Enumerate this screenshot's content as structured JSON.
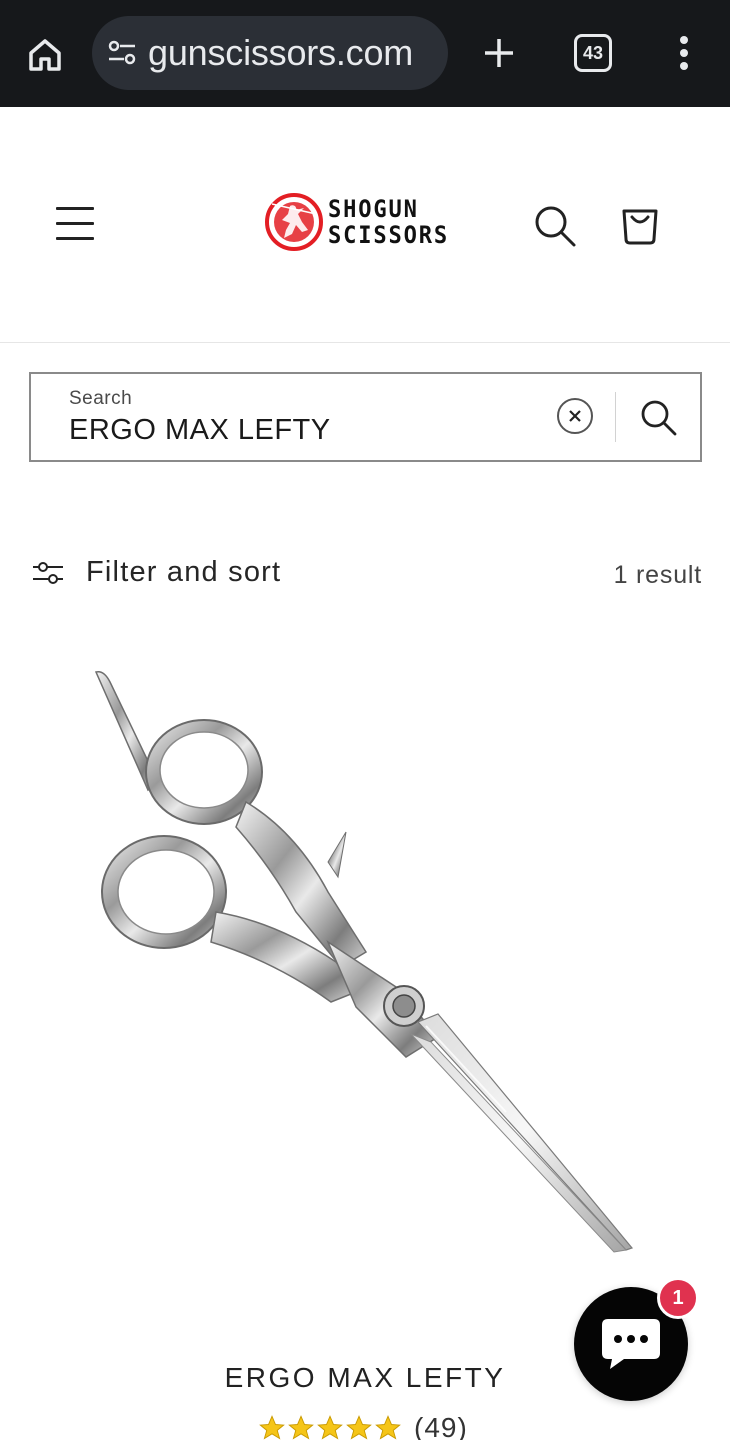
{
  "browser": {
    "url": "gunscissors.com",
    "tab_count": "43",
    "icons": {
      "home": "home-icon",
      "site_settings": "tune-icon",
      "new_tab": "plus-icon",
      "menu": "more-vertical-icon"
    }
  },
  "header": {
    "logo": {
      "line1": "SHOGUN",
      "line2": "SCISSORS",
      "brand_color": "#e31e24"
    },
    "icons": {
      "menu": "hamburger-icon",
      "search": "search-icon",
      "cart": "cart-icon"
    }
  },
  "search": {
    "label": "Search",
    "value": "ERGO MAX LEFTY",
    "icons": {
      "clear": "close-icon",
      "submit": "search-icon"
    }
  },
  "filter": {
    "label": "Filter and sort",
    "result_count": "1 result",
    "icon": "sliders-icon"
  },
  "products": [
    {
      "title": "ERGO MAX LEFTY",
      "rating_stars": 5,
      "rating_count": "(49)",
      "star_color": "#f5c518",
      "image": "hair-scissors"
    }
  ],
  "chat": {
    "badge": "1",
    "badge_color": "#e0324f",
    "icon": "chat-bubble-icon"
  }
}
